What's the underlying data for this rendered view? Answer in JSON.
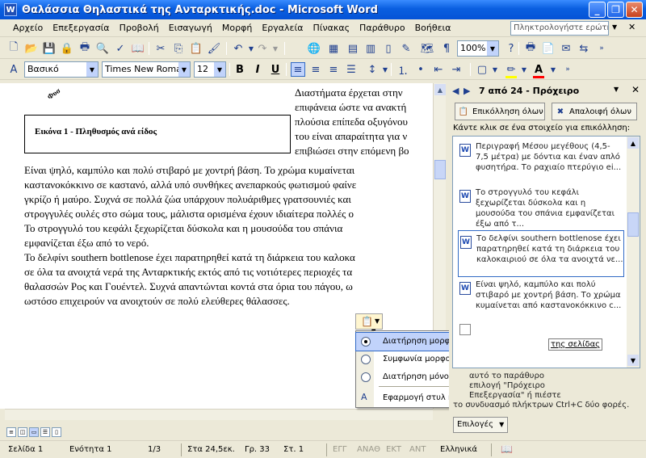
{
  "window": {
    "title": "Θαλάσσια Θηλαστικά της Ανταρκτικής.doc - Microsoft Word",
    "app_icon": "W"
  },
  "menu": [
    "Αρχείο",
    "Επεξεργασία",
    "Προβολή",
    "Εισαγωγή",
    "Μορφή",
    "Εργαλεία",
    "Πίνακας",
    "Παράθυρο",
    "Βοήθεια"
  ],
  "help_placeholder": "Πληκτρολογήστε ερώτηση",
  "toolbar": {
    "zoom": "100%",
    "style": "Βασικό",
    "font": "Times New Roman",
    "font_size": "12",
    "bold": "B",
    "italic": "I",
    "underline": "U",
    "highlight_color": "#FFFF00",
    "font_color": "#FF0000"
  },
  "document": {
    "rotated_fragment": "Φυσ",
    "caption": "Εικόνα 1 - Πληθυσμός ανά είδος",
    "wrap_lines": [
      "Διαστήματα έρχεται στην",
      "επιφάνεια ώστε να ανακτή",
      "πλούσια επίπεδα οξυγόνου",
      "του είναι απαραίτητα για ν",
      "επιβιώσει στην επόμενη βο"
    ],
    "lines": [
      "Είναι ψηλό, καμπύλο και πολύ στιβαρό με χοντρή βάση. Το χρώμα κυμαίνεται",
      "καστανοκόκκινο σε καστανό, αλλά υπό συνθήκες ανεπαρκούς φωτισμού φαίνε",
      "γκρίζο ή μαύρο. Συχνά σε πολλά ζώα υπάρχουν πολυάριθμες γρατσουνιές και",
      "στρογγυλές ουλές στο σώμα τους, μάλιστα ορισμένα έχουν ιδιαίτερα πολλές ο",
      "Το στρογγυλό του κεφάλι ξεχωρίζεται δύσκολα και η μουσούδα του σπάνια",
      "εμφανίζεται έξω από το νερό.",
      "Το δελφίνι southern bottlenose έχει παρατηρηθεί κατά τη διάρκεια του καλοκα",
      "σε όλα τα ανοιχτά νερά της Ανταρκτικής εκτός από τις νοτιότερες περιοχές τα",
      "θαλασσών Ρος και Γουέντελ. Συχνά απαντώνται κοντά στα όρια του πάγου, ω",
      "ωστόσο επιχειρούν να ανοιχτούν σε πολύ ελεύθερες θάλασσες."
    ]
  },
  "paste_menu": {
    "items": [
      {
        "label": "Διατήρηση μορφοποίησης προέλευσης",
        "selected": true
      },
      {
        "label": "Συμφωνία μορφοποίησης προορισμού",
        "selected": false
      },
      {
        "label": "Διατήρηση μόνο κειμένου",
        "selected": false
      }
    ],
    "apply_label": "Εφαρμογή στυλ ή μορφοποίησης..."
  },
  "task_pane": {
    "title": "7 από 24 - Πρόχειρο",
    "paste_all": "Επικόλληση όλων",
    "clear_all": "Απαλοιφή όλων",
    "instruction": "Κάντε κλικ σε ένα στοιχείο για επικόλληση:",
    "clips": [
      "Περιγραφή Μέσου μεγέθους (4,5-7,5 μέτρα) με δόντια και έναν απλό φυσητήρα. Το ραχιαίο πτερύγιο ei...",
      "Το στρογγυλό του κεφάλι ξεχωρίζεται δύσκολα και η μουσούδα του σπάνια εμφανίζεται έξω από τ...",
      "Το δελφίνι southern bottlenose έχει παρατηρηθεί κατά τη διάρκεια του καλοκαιριού σε όλα τα ανοιχτά νε...",
      "Είναι ψηλό, καμπύλο και πολύ στιβαρό με χοντρή βάση. Το χρώμα κυμαίνεται από καστανοκόκκινο c..."
    ],
    "partial_link": "της σελίδας",
    "footer_lines": [
      "αυτό το παράθυρο",
      "επιλογή \"Πρόχειρο",
      "Επεξεργασία\" ή πιέστε",
      "το συνδυασμό πλήκτρων Ctrl+C δύο φορές."
    ],
    "options": "Επιλογές"
  },
  "status": {
    "page": "Σελίδα 1",
    "section": "Ενότητα 1",
    "pages": "1/3",
    "at": "Στα 24,5εκ.",
    "line": "Γρ. 33",
    "col": "Στ. 1",
    "rec": "ΕΓΓ",
    "trk": "ΑΝΑΘ",
    "ext": "ΕΚΤ",
    "ovr": "ΑΝΤ",
    "language": "Ελληνικά"
  }
}
